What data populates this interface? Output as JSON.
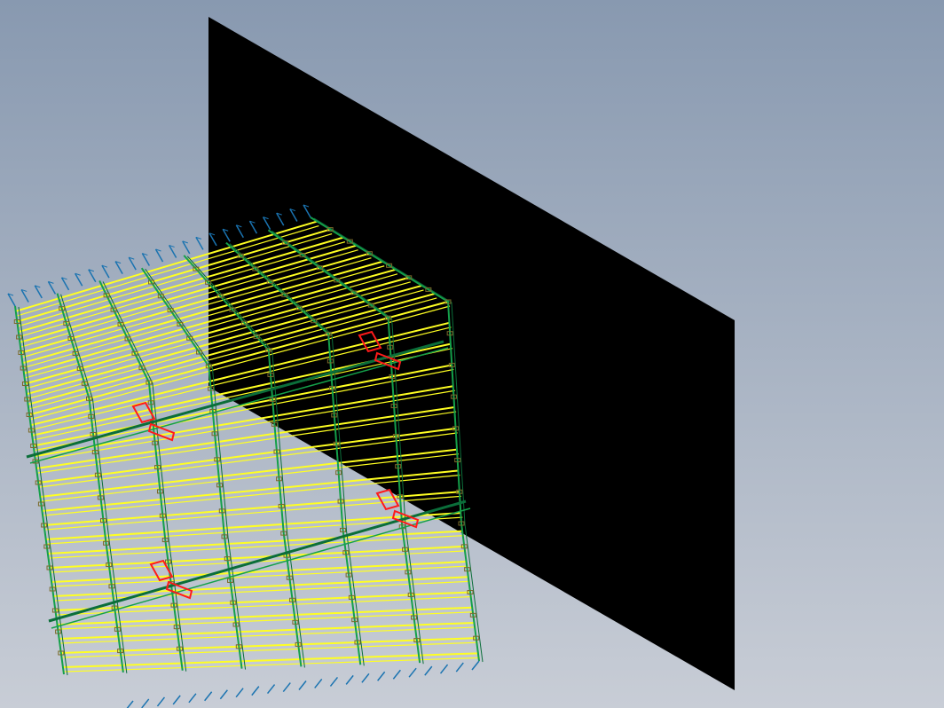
{
  "viewport": {
    "kind": "3D CAD wireframe view",
    "background_top": "#8899b0",
    "background_bottom": "#c8cdd6"
  },
  "colors": {
    "panel": "#000000",
    "cross_bars": "#ffff22",
    "bearer_bars": "#14a04a",
    "bearer_dark": "#0b6e3a",
    "edge_ticks": "#1a73b0",
    "clips": "#ff1a1a",
    "bolt_marks": "#7a6a2a"
  },
  "objects": {
    "panel": "black-plane",
    "grating": "grating-assembly",
    "bearer_count": 8,
    "cross_bar_count": 30,
    "clip_count": 4
  }
}
